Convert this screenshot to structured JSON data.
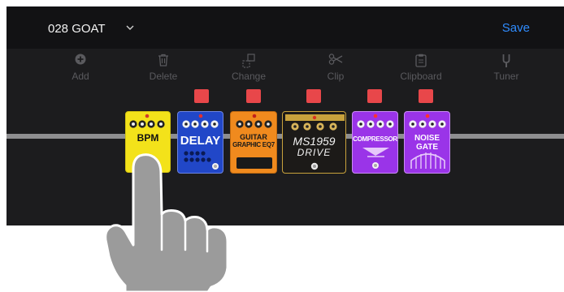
{
  "header": {
    "preset_name": "028 GOAT",
    "save_label": "Save",
    "chevron": "chevron-down-icon"
  },
  "toolbar": [
    {
      "label": "Add",
      "icon": "plus-circle-icon"
    },
    {
      "label": "Delete",
      "icon": "trash-icon"
    },
    {
      "label": "Change",
      "icon": "swap-icon"
    },
    {
      "label": "Clip",
      "icon": "scissors-icon"
    },
    {
      "label": "Clipboard",
      "icon": "clipboard-icon"
    },
    {
      "label": "Tuner",
      "icon": "tuning-fork-icon"
    }
  ],
  "pedals": [
    {
      "name": "BPM",
      "color": "#f3e21a",
      "toggle": false
    },
    {
      "name": "DELAY",
      "color": "#2147c8",
      "toggle": true
    },
    {
      "name_line1": "GUITAR",
      "name_line2": "GRAPHIC EQ7",
      "color": "#f08a1e",
      "toggle": true
    },
    {
      "name_line1": "MS1959",
      "name_line2": "DRIVE",
      "color": "#1c1a18",
      "toggle": true
    },
    {
      "name": "COMPRESSOR",
      "color": "#9a34e8",
      "toggle": true
    },
    {
      "name_line1": "NOISE",
      "name_line2": "GATE",
      "color": "#9a34e8",
      "toggle": true
    }
  ],
  "colors": {
    "accent": "#2f8cff",
    "toggle_red": "#e8474a",
    "background": "#1c1c1e"
  },
  "gesture": {
    "icon": "tap-hand-icon"
  }
}
